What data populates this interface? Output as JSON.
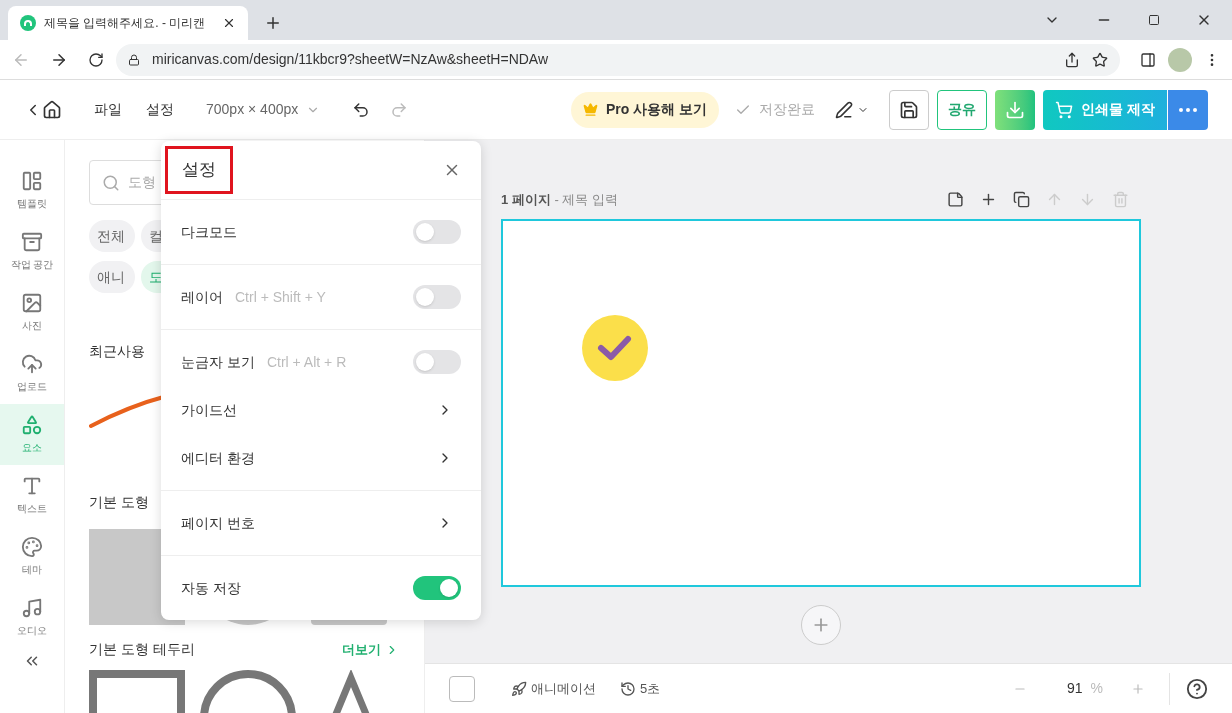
{
  "browser": {
    "tab_title": "제목을 입력해주세요. - 미리캔",
    "url": "miricanvas.com/design/11kbcr9?sheetW=NzAw&sheetH=NDAw"
  },
  "header": {
    "menus": [
      "파일",
      "설정"
    ],
    "size": "700px × 400px",
    "pro": "Pro 사용해 보기",
    "save_status": "저장완료",
    "share": "공유",
    "print": "인쇄물 제작"
  },
  "sidebar": {
    "items": [
      {
        "label": "템플릿",
        "selected": false
      },
      {
        "label": "작업 공간",
        "selected": false
      },
      {
        "label": "사진",
        "selected": false
      },
      {
        "label": "업로드",
        "selected": false
      },
      {
        "label": "요소",
        "selected": true
      },
      {
        "label": "텍스트",
        "selected": false
      },
      {
        "label": "테마",
        "selected": false
      },
      {
        "label": "오디오",
        "selected": false
      }
    ]
  },
  "panel": {
    "search_placeholder": "도형",
    "chips": [
      {
        "label": "전체",
        "selected": false
      },
      {
        "label": "컬",
        "selected": false
      },
      {
        "label": "애니",
        "selected": false
      },
      {
        "label": "도",
        "selected": true
      }
    ],
    "sections": [
      "최근사용",
      "기본 도형",
      "기본 도형 테두리"
    ],
    "more": "더보기"
  },
  "settings": {
    "title": "설정",
    "title_highlighted": true,
    "groups": [
      [
        {
          "kind": "toggle",
          "label": "다크모드",
          "on": false
        }
      ],
      [
        {
          "kind": "toggle",
          "label": "레이어",
          "shortcut": "Ctrl + Shift + Y",
          "on": false
        }
      ],
      [
        {
          "kind": "toggle",
          "label": "눈금자 보기",
          "shortcut": "Ctrl + Alt + R",
          "on": false
        },
        {
          "kind": "submenu",
          "label": "가이드선"
        },
        {
          "kind": "submenu",
          "label": "에디터 환경"
        }
      ],
      [
        {
          "kind": "submenu",
          "label": "페이지 번호"
        }
      ],
      [
        {
          "kind": "toggle",
          "label": "자동 저장",
          "on": true
        }
      ]
    ]
  },
  "page": {
    "number": "1 페이지",
    "title_placeholder": "- 제목 입력"
  },
  "bottom_bar": {
    "checked": false,
    "animation": "애니메이션",
    "history": "5초",
    "zoom": "91",
    "zoom_unit": "%"
  }
}
